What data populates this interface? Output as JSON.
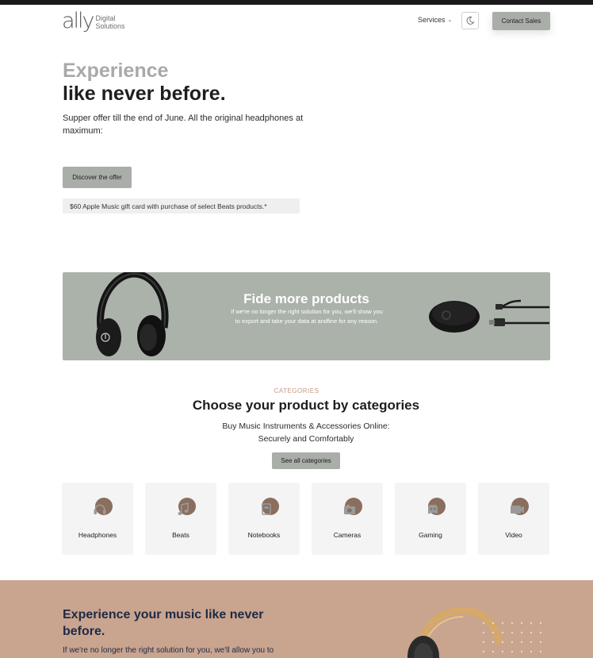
{
  "header": {
    "logo": {
      "mark": "ally",
      "line1": "Digital",
      "line2": "Solutions"
    },
    "nav_services": "Services",
    "contact_button": "Contact Sales",
    "theme_icon": "moon-icon"
  },
  "hero": {
    "title_line1": "Experience",
    "title_line2": "like never before.",
    "description": "Supper offer till the end of June. All the original headphones at maximum:",
    "cta": "Discover the offer",
    "gift_note": "$60 Apple Music gift card with purchase of select Beats products.*"
  },
  "promo": {
    "title": "Fide more products",
    "text": "If we're no longer the right solution for you, we'll show you to export and take your data at andfine for any reason."
  },
  "categories": {
    "kicker": "CATEGORIES",
    "title": "Choose your product by categories",
    "subtitle_line1": "Buy Music Instruments & Accessories Online:",
    "subtitle_line2": "Securely and Comfortably",
    "see_all": "See all categories",
    "items": [
      {
        "label": "Headphones",
        "icon": "headphones-icon"
      },
      {
        "label": "Beats",
        "icon": "music-note-icon"
      },
      {
        "label": "Notebooks",
        "icon": "notebook-icon"
      },
      {
        "label": "Cameras",
        "icon": "camera-icon"
      },
      {
        "label": "Gaming",
        "icon": "gamepad-icon"
      },
      {
        "label": "Video",
        "icon": "video-icon"
      }
    ]
  },
  "feature": {
    "title": "Experience your music like never before.",
    "text": "If we're no longer the right solution for you, we'll allow you to"
  },
  "colors": {
    "accent_gray": "#a9aea8",
    "banner_bg": "#aab2aa",
    "kicker": "#c49a82",
    "icon_circle": "#8a6e5e",
    "bottom_bg": "#c9a48f"
  }
}
